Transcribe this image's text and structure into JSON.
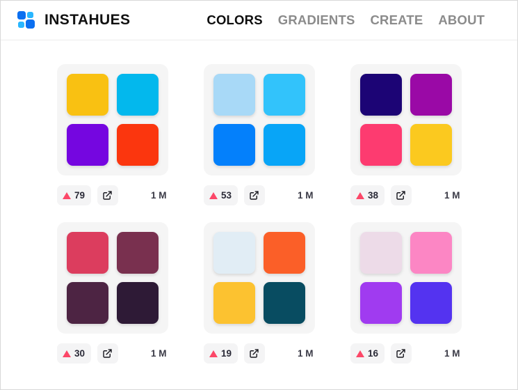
{
  "header": {
    "brand": "INSTAHUES",
    "logo_icon": "instahues-blocks-logo",
    "nav": [
      {
        "label": "COLORS",
        "active": true
      },
      {
        "label": "GRADIENTS",
        "active": false
      },
      {
        "label": "CREATE",
        "active": false
      },
      {
        "label": "ABOUT",
        "active": false
      }
    ]
  },
  "accent": {
    "vote_triangle": "#fc4768",
    "nav_active": "#0d0d0d",
    "nav_inactive": "#8b8b8b",
    "logo_dark_blue": "#0b6ff0",
    "logo_light_blue": "#29b6ff",
    "panel_bg": "#f5f5f5",
    "button_bg": "#f4f4f5"
  },
  "icons": {
    "vote": "triangle-up-icon",
    "share": "external-link-icon"
  },
  "palettes": [
    {
      "votes": "79",
      "views": "1 M",
      "colors": [
        "#f9c112",
        "#03b8ed",
        "#7506e0",
        "#fb360e"
      ]
    },
    {
      "votes": "53",
      "views": "1 M",
      "colors": [
        "#a8d9f7",
        "#32c3fb",
        "#0480fb",
        "#08a5f7"
      ]
    },
    {
      "votes": "38",
      "views": "1 M",
      "colors": [
        "#1c0475",
        "#9a09a6",
        "#fd3b70",
        "#fbc91f"
      ]
    },
    {
      "votes": "30",
      "views": "1 M",
      "colors": [
        "#dc3d5e",
        "#79304f",
        "#4d2443",
        "#2e1a36"
      ]
    },
    {
      "votes": "19",
      "views": "1 M",
      "colors": [
        "#e1edf5",
        "#fb5f28",
        "#fcc230",
        "#084c61"
      ]
    },
    {
      "votes": "16",
      "views": "1 M",
      "colors": [
        "#eddbe8",
        "#fc86c4",
        "#a03bf0",
        "#5433f0"
      ]
    }
  ]
}
